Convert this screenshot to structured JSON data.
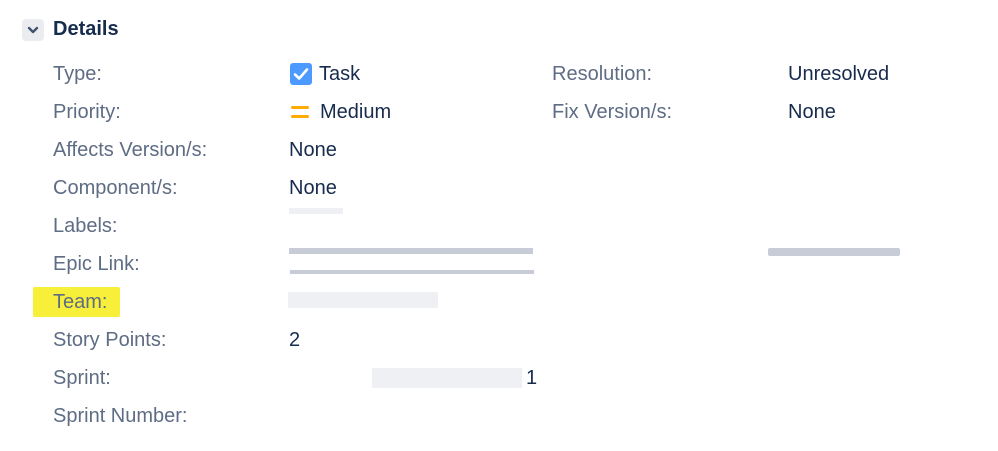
{
  "section": {
    "title": "Details",
    "toggle_icon": "chevron-down-icon"
  },
  "fields": {
    "type": {
      "label": "Type:",
      "value": "Task",
      "icon": "task-checkbox-icon",
      "icon_color": "#4c9aff"
    },
    "priority": {
      "label": "Priority:",
      "value": "Medium",
      "icon": "medium-priority-icon",
      "icon_color": "#ffab00"
    },
    "affects_versions": {
      "label": "Affects Version/s:",
      "value": "None"
    },
    "components": {
      "label": "Component/s:",
      "value": "None"
    },
    "labels": {
      "label": "Labels:"
    },
    "epic_link": {
      "label": "Epic Link:"
    },
    "team": {
      "label": "Team:",
      "highlight_color": "#f8ef3a"
    },
    "story_points": {
      "label": "Story Points:",
      "value": "2"
    },
    "sprint": {
      "label": "Sprint:",
      "value_visible_fragment": "1"
    },
    "sprint_number": {
      "label": "Sprint Number:"
    },
    "resolution": {
      "label": "Resolution:",
      "value": "Unresolved"
    },
    "fix_versions": {
      "label": "Fix Version/s:",
      "value": "None"
    }
  }
}
